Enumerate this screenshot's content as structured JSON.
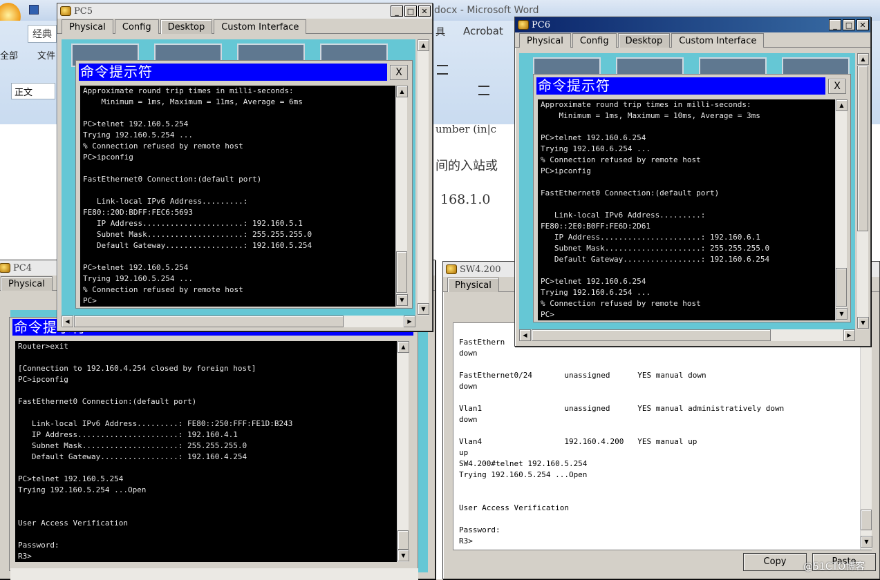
{
  "word": {
    "title": "docx - Microsoft Word",
    "ribbon_tab_1": "经典",
    "ribbon_tab_acrobat": "Acrobat",
    "ribbon_tab_tool": "具",
    "menu_1": "全部",
    "menu_2": "文件",
    "style_box": "正文",
    "doc_line_1": "umber (in|c",
    "doc_line_2": "间的入站或",
    "doc_line_3": "168.1.0"
  },
  "pc5": {
    "title": "PC5",
    "tabs": [
      "Physical",
      "Config",
      "Desktop",
      "Custom Interface"
    ],
    "cmd_title": "命令提示符",
    "close": "X",
    "terminal": "Approximate round trip times in milli-seconds:\n    Minimum = 1ms, Maximum = 11ms, Average = 6ms\n\nPC>telnet 192.160.5.254\nTrying 192.160.5.254 ...\n% Connection refused by remote host\nPC>ipconfig\n\nFastEthernet0 Connection:(default port)\n\n   Link-local IPv6 Address.........:\nFE80::20D:BDFF:FEC6:5693\n   IP Address......................: 192.160.5.1\n   Subnet Mask.....................: 255.255.255.0\n   Default Gateway.................: 192.160.5.254\n\nPC>telnet 192.160.5.254\nTrying 192.160.5.254 ...\n% Connection refused by remote host\nPC>"
  },
  "pc6": {
    "title": "PC6",
    "tabs": [
      "Physical",
      "Config",
      "Desktop",
      "Custom Interface"
    ],
    "cmd_title": "命令提示符",
    "close": "X",
    "terminal": "Approximate round trip times in milli-seconds:\n    Minimum = 1ms, Maximum = 10ms, Average = 3ms\n\nPC>telnet 192.160.6.254\nTrying 192.160.6.254 ...\n% Connection refused by remote host\nPC>ipconfig\n\nFastEthernet0 Connection:(default port)\n\n   Link-local IPv6 Address.........:\nFE80::2E0:B0FF:FE6D:2D61\n   IP Address......................: 192.160.6.1\n   Subnet Mask.....................: 255.255.255.0\n   Default Gateway.................: 192.160.6.254\n\nPC>telnet 192.160.6.254\nTrying 192.160.6.254 ...\n% Connection refused by remote host\nPC>"
  },
  "pc4": {
    "title": "PC4",
    "tab_physical": "Physical",
    "cmd_title": "命令提示符",
    "terminal": "Router>exit\n\n[Connection to 192.160.4.254 closed by foreign host]\nPC>ipconfig\n\nFastEthernet0 Connection:(default port)\n\n   Link-local IPv6 Address.........: FE80::250:FFF:FE1D:B243\n   IP Address......................: 192.160.4.1\n   Subnet Mask.....................: 255.255.255.0\n   Default Gateway.................: 192.160.4.254\n\nPC>telnet 192.160.5.254\nTrying 192.160.5.254 ...Open\n\n\nUser Access Verification\n\nPassword:\nR3>"
  },
  "sw": {
    "title": "SW4.200",
    "tab_physical": "Physical",
    "terminal": "FastEthern\ndown\n\nFastEthernet0/24       unassigned      YES manual down\ndown\n\nVlan1                  unassigned      YES manual administratively down\ndown\n\nVlan4                  192.160.4.200   YES manual up\nup\nSW4.200#telnet 192.160.5.254\nTrying 192.160.5.254 ...Open\n\n\nUser Access Verification\n\nPassword:\nR3>",
    "copy_button": "Copy",
    "paste_button": "Paste"
  },
  "watermark": "@51CTO博客",
  "colors": {
    "titlebar_active": "#0a246a",
    "cmd_title_bg": "#0000ff",
    "desktop_bg": "#65c7d5",
    "terminal_bg": "#000000"
  }
}
